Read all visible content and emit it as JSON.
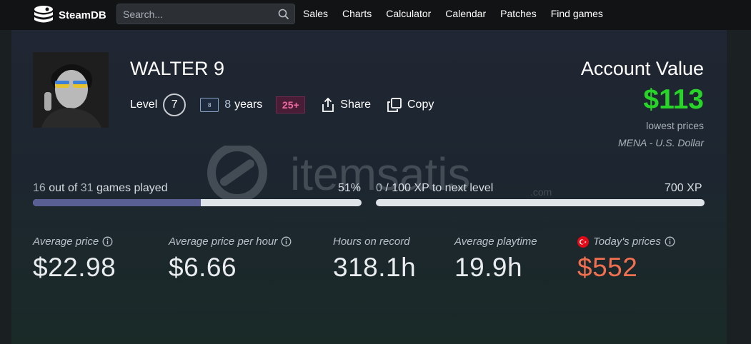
{
  "nav": {
    "brand": "SteamDB",
    "search_placeholder": "Search...",
    "links": [
      "Sales",
      "Charts",
      "Calculator",
      "Calendar",
      "Patches",
      "Find games"
    ]
  },
  "profile": {
    "name": "WALTER 9",
    "level_label": "Level",
    "level": "7",
    "years_badge": "8",
    "years_num": "8",
    "years_text": "years",
    "games_badge": "25+",
    "share_label": "Share",
    "copy_label": "Copy"
  },
  "account": {
    "title": "Account Value",
    "value": "$113",
    "note": "lowest prices",
    "region": "MENA - U.S. Dollar"
  },
  "progress": {
    "games_played": "16",
    "games_total": "31",
    "games_text": "games played",
    "games_percent_label": "51%",
    "games_fraction": 0.51,
    "xp_current": "0",
    "xp_needed": "100 XP to next level",
    "xp_total_label": "700 XP",
    "xp_fraction": 0.0
  },
  "stats": [
    {
      "label": "Average price",
      "value": "$22.98"
    },
    {
      "label": "Average price per hour",
      "value": "$6.66"
    },
    {
      "label": "Hours on record",
      "value": "318.1h"
    },
    {
      "label": "Average playtime",
      "value": "19.9h"
    },
    {
      "label": "Today's prices",
      "value": "$552"
    }
  ],
  "watermark": {
    "text": "itemsatis",
    "sub": ".com"
  },
  "colors": {
    "accent_green": "#27d427",
    "accent_orange": "#f26f4f",
    "bar_fill": "#5a5f93"
  }
}
